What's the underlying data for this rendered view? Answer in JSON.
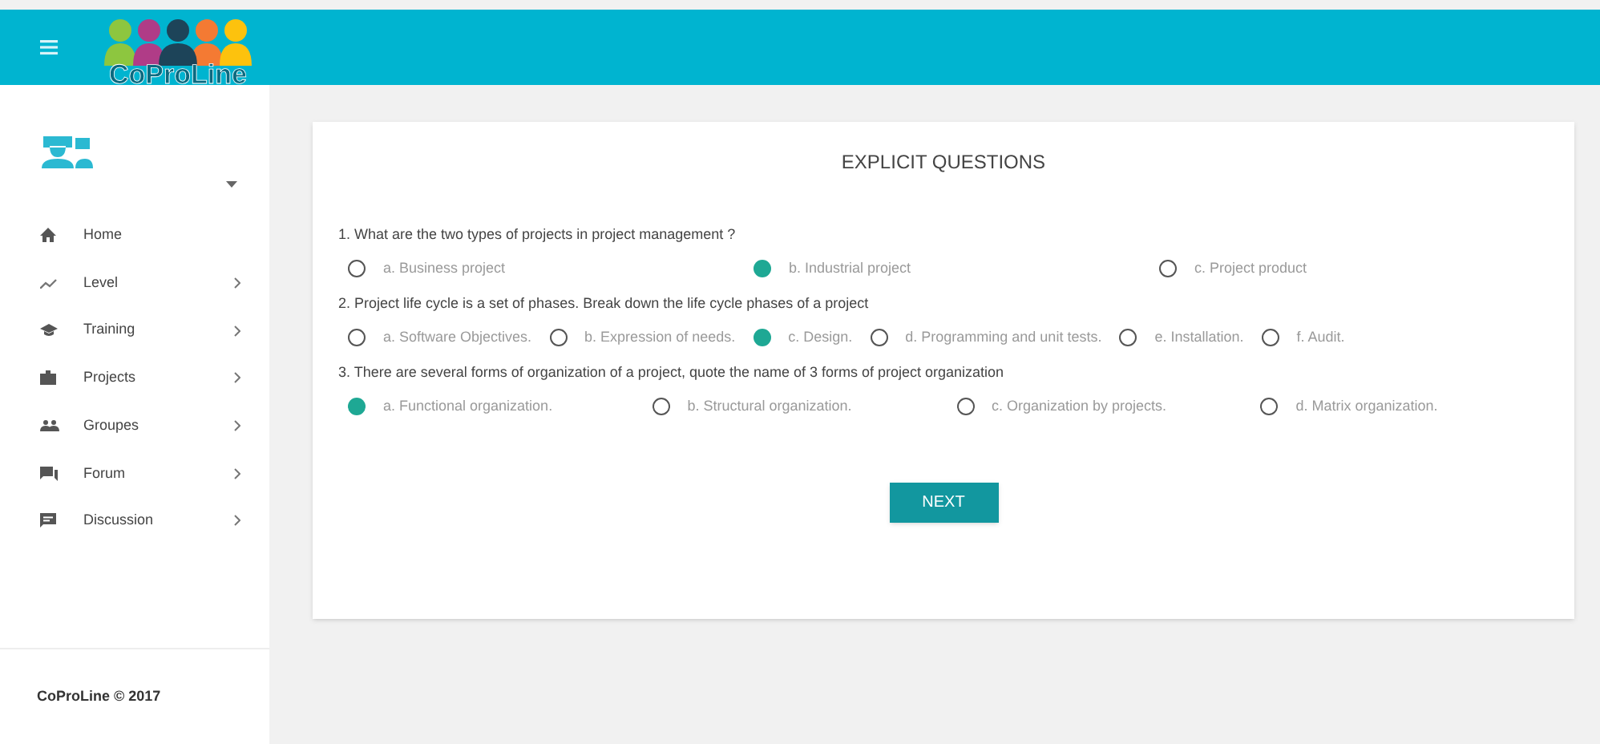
{
  "header": {
    "logo_text": "CoProLine"
  },
  "sidebar": {
    "items": [
      {
        "label": "Home",
        "submenu": false
      },
      {
        "label": "Level",
        "submenu": true
      },
      {
        "label": "Training",
        "submenu": true
      },
      {
        "label": "Projects",
        "submenu": true
      },
      {
        "label": "Groupes",
        "submenu": true
      },
      {
        "label": "Forum",
        "submenu": true
      },
      {
        "label": "Discussion",
        "submenu": true
      }
    ],
    "footer": "CoProLine © 2017"
  },
  "quiz": {
    "title": "EXPLICIT QUESTIONS",
    "questions": [
      {
        "text": "1. What are the two types of projects in project management ?",
        "options": [
          {
            "label": "a. Business project",
            "selected": false
          },
          {
            "label": "b. Industrial project",
            "selected": true
          },
          {
            "label": "c. Project product",
            "selected": false
          }
        ]
      },
      {
        "text": "2. Project life cycle is a set of phases. Break down the life cycle phases of a project",
        "options": [
          {
            "label": "a. Software Objectives.",
            "selected": false
          },
          {
            "label": "b. Expression of needs.",
            "selected": false
          },
          {
            "label": "c. Design.",
            "selected": true
          },
          {
            "label": "d. Programming and unit tests.",
            "selected": false
          },
          {
            "label": "e. Installation.",
            "selected": false
          },
          {
            "label": "f. Audit.",
            "selected": false
          }
        ]
      },
      {
        "text": "3. There are several forms of organization of a project, quote the name of 3 forms of project organization",
        "options": [
          {
            "label": "a. Functional organization.",
            "selected": true
          },
          {
            "label": "b. Structural organization.",
            "selected": false
          },
          {
            "label": "c. Organization by projects.",
            "selected": false
          },
          {
            "label": "d. Matrix organization.",
            "selected": false
          }
        ]
      }
    ],
    "button": "NEXT"
  }
}
